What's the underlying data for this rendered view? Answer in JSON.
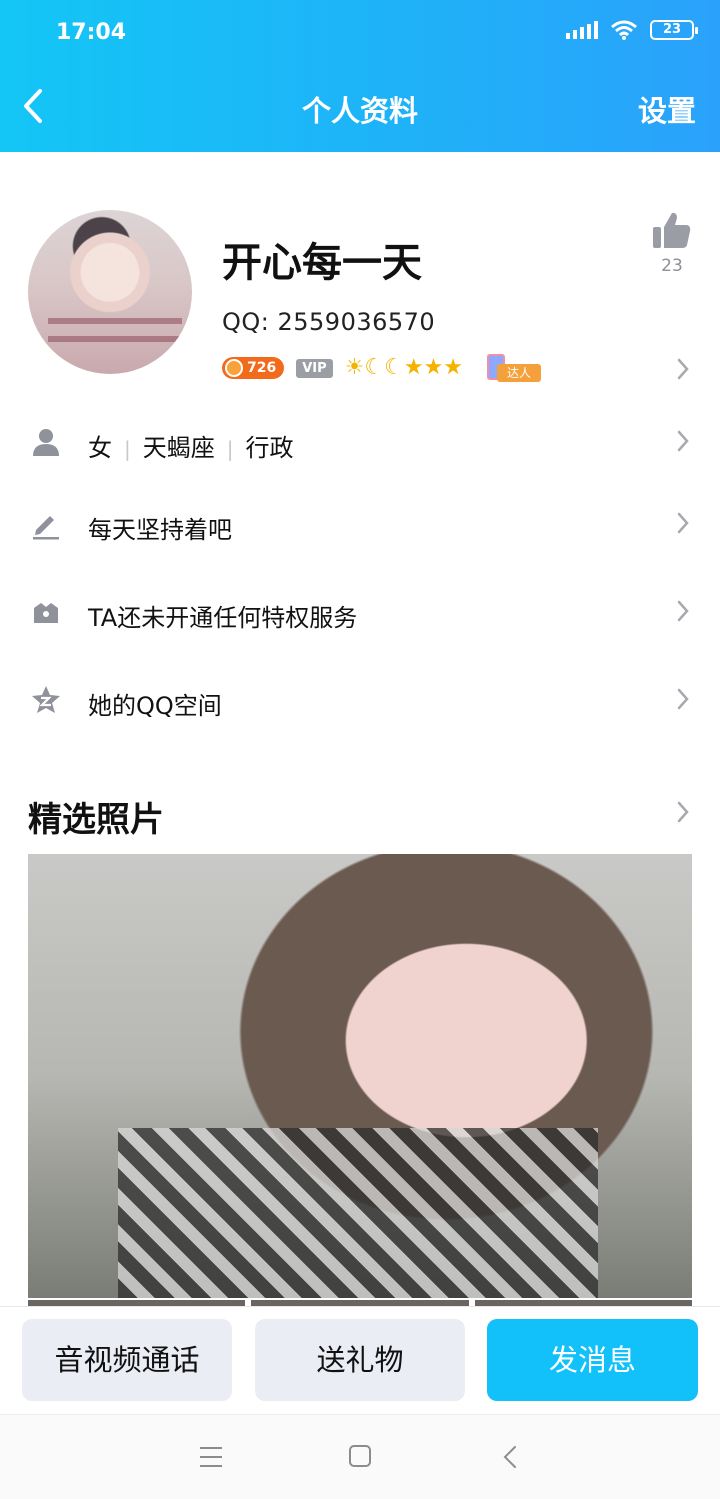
{
  "status_bar": {
    "time": "17:04",
    "battery": "23"
  },
  "nav": {
    "title": "个人资料",
    "settings_label": "设置"
  },
  "profile": {
    "nickname": "开心每一天",
    "qq_label": "QQ: 2559036570",
    "like_count": "23",
    "level": "726",
    "vip_label": "VIP",
    "ranks": "☀☾☾★★★",
    "daren_label": "达人"
  },
  "info_rows": [
    {
      "gender": "女",
      "zodiac": "天蝎座",
      "job": "行政",
      "icon": "person-icon"
    },
    {
      "text": "每天坚持着吧",
      "icon": "pencil-icon"
    },
    {
      "text": "TA还未开通任何特权服务",
      "icon": "crown-icon"
    },
    {
      "text": "她的QQ空间",
      "icon": "qzone-star-icon"
    }
  ],
  "photos": {
    "title": "精选照片"
  },
  "actions": {
    "call_label": "音视频通话",
    "gift_label": "送礼物",
    "message_label": "发消息"
  },
  "colors": {
    "header": "#1fb2f8",
    "primary_button": "#12c0fa",
    "secondary_button": "#ebedf5"
  }
}
